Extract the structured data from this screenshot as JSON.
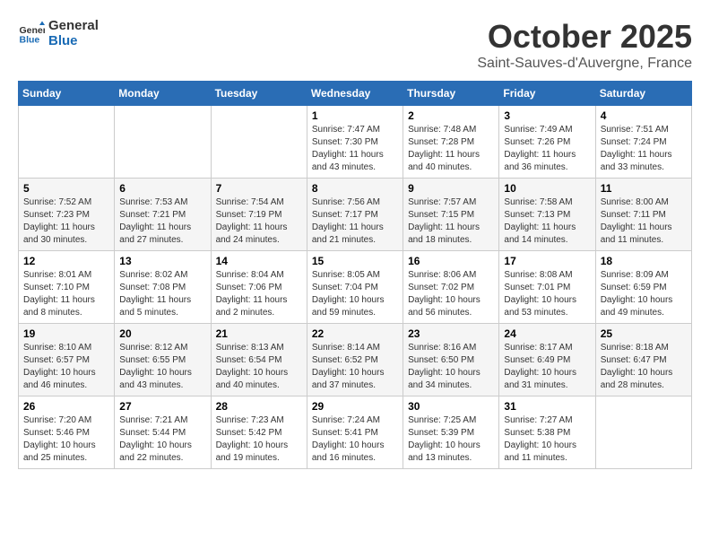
{
  "header": {
    "logo_line1": "General",
    "logo_line2": "Blue",
    "month_title": "October 2025",
    "subtitle": "Saint-Sauves-d'Auvergne, France"
  },
  "days_of_week": [
    "Sunday",
    "Monday",
    "Tuesday",
    "Wednesday",
    "Thursday",
    "Friday",
    "Saturday"
  ],
  "weeks": [
    [
      {
        "day": "",
        "info": ""
      },
      {
        "day": "",
        "info": ""
      },
      {
        "day": "",
        "info": ""
      },
      {
        "day": "1",
        "info": "Sunrise: 7:47 AM\nSunset: 7:30 PM\nDaylight: 11 hours\nand 43 minutes."
      },
      {
        "day": "2",
        "info": "Sunrise: 7:48 AM\nSunset: 7:28 PM\nDaylight: 11 hours\nand 40 minutes."
      },
      {
        "day": "3",
        "info": "Sunrise: 7:49 AM\nSunset: 7:26 PM\nDaylight: 11 hours\nand 36 minutes."
      },
      {
        "day": "4",
        "info": "Sunrise: 7:51 AM\nSunset: 7:24 PM\nDaylight: 11 hours\nand 33 minutes."
      }
    ],
    [
      {
        "day": "5",
        "info": "Sunrise: 7:52 AM\nSunset: 7:23 PM\nDaylight: 11 hours\nand 30 minutes."
      },
      {
        "day": "6",
        "info": "Sunrise: 7:53 AM\nSunset: 7:21 PM\nDaylight: 11 hours\nand 27 minutes."
      },
      {
        "day": "7",
        "info": "Sunrise: 7:54 AM\nSunset: 7:19 PM\nDaylight: 11 hours\nand 24 minutes."
      },
      {
        "day": "8",
        "info": "Sunrise: 7:56 AM\nSunset: 7:17 PM\nDaylight: 11 hours\nand 21 minutes."
      },
      {
        "day": "9",
        "info": "Sunrise: 7:57 AM\nSunset: 7:15 PM\nDaylight: 11 hours\nand 18 minutes."
      },
      {
        "day": "10",
        "info": "Sunrise: 7:58 AM\nSunset: 7:13 PM\nDaylight: 11 hours\nand 14 minutes."
      },
      {
        "day": "11",
        "info": "Sunrise: 8:00 AM\nSunset: 7:11 PM\nDaylight: 11 hours\nand 11 minutes."
      }
    ],
    [
      {
        "day": "12",
        "info": "Sunrise: 8:01 AM\nSunset: 7:10 PM\nDaylight: 11 hours\nand 8 minutes."
      },
      {
        "day": "13",
        "info": "Sunrise: 8:02 AM\nSunset: 7:08 PM\nDaylight: 11 hours\nand 5 minutes."
      },
      {
        "day": "14",
        "info": "Sunrise: 8:04 AM\nSunset: 7:06 PM\nDaylight: 11 hours\nand 2 minutes."
      },
      {
        "day": "15",
        "info": "Sunrise: 8:05 AM\nSunset: 7:04 PM\nDaylight: 10 hours\nand 59 minutes."
      },
      {
        "day": "16",
        "info": "Sunrise: 8:06 AM\nSunset: 7:02 PM\nDaylight: 10 hours\nand 56 minutes."
      },
      {
        "day": "17",
        "info": "Sunrise: 8:08 AM\nSunset: 7:01 PM\nDaylight: 10 hours\nand 53 minutes."
      },
      {
        "day": "18",
        "info": "Sunrise: 8:09 AM\nSunset: 6:59 PM\nDaylight: 10 hours\nand 49 minutes."
      }
    ],
    [
      {
        "day": "19",
        "info": "Sunrise: 8:10 AM\nSunset: 6:57 PM\nDaylight: 10 hours\nand 46 minutes."
      },
      {
        "day": "20",
        "info": "Sunrise: 8:12 AM\nSunset: 6:55 PM\nDaylight: 10 hours\nand 43 minutes."
      },
      {
        "day": "21",
        "info": "Sunrise: 8:13 AM\nSunset: 6:54 PM\nDaylight: 10 hours\nand 40 minutes."
      },
      {
        "day": "22",
        "info": "Sunrise: 8:14 AM\nSunset: 6:52 PM\nDaylight: 10 hours\nand 37 minutes."
      },
      {
        "day": "23",
        "info": "Sunrise: 8:16 AM\nSunset: 6:50 PM\nDaylight: 10 hours\nand 34 minutes."
      },
      {
        "day": "24",
        "info": "Sunrise: 8:17 AM\nSunset: 6:49 PM\nDaylight: 10 hours\nand 31 minutes."
      },
      {
        "day": "25",
        "info": "Sunrise: 8:18 AM\nSunset: 6:47 PM\nDaylight: 10 hours\nand 28 minutes."
      }
    ],
    [
      {
        "day": "26",
        "info": "Sunrise: 7:20 AM\nSunset: 5:46 PM\nDaylight: 10 hours\nand 25 minutes."
      },
      {
        "day": "27",
        "info": "Sunrise: 7:21 AM\nSunset: 5:44 PM\nDaylight: 10 hours\nand 22 minutes."
      },
      {
        "day": "28",
        "info": "Sunrise: 7:23 AM\nSunset: 5:42 PM\nDaylight: 10 hours\nand 19 minutes."
      },
      {
        "day": "29",
        "info": "Sunrise: 7:24 AM\nSunset: 5:41 PM\nDaylight: 10 hours\nand 16 minutes."
      },
      {
        "day": "30",
        "info": "Sunrise: 7:25 AM\nSunset: 5:39 PM\nDaylight: 10 hours\nand 13 minutes."
      },
      {
        "day": "31",
        "info": "Sunrise: 7:27 AM\nSunset: 5:38 PM\nDaylight: 10 hours\nand 11 minutes."
      },
      {
        "day": "",
        "info": ""
      }
    ]
  ]
}
